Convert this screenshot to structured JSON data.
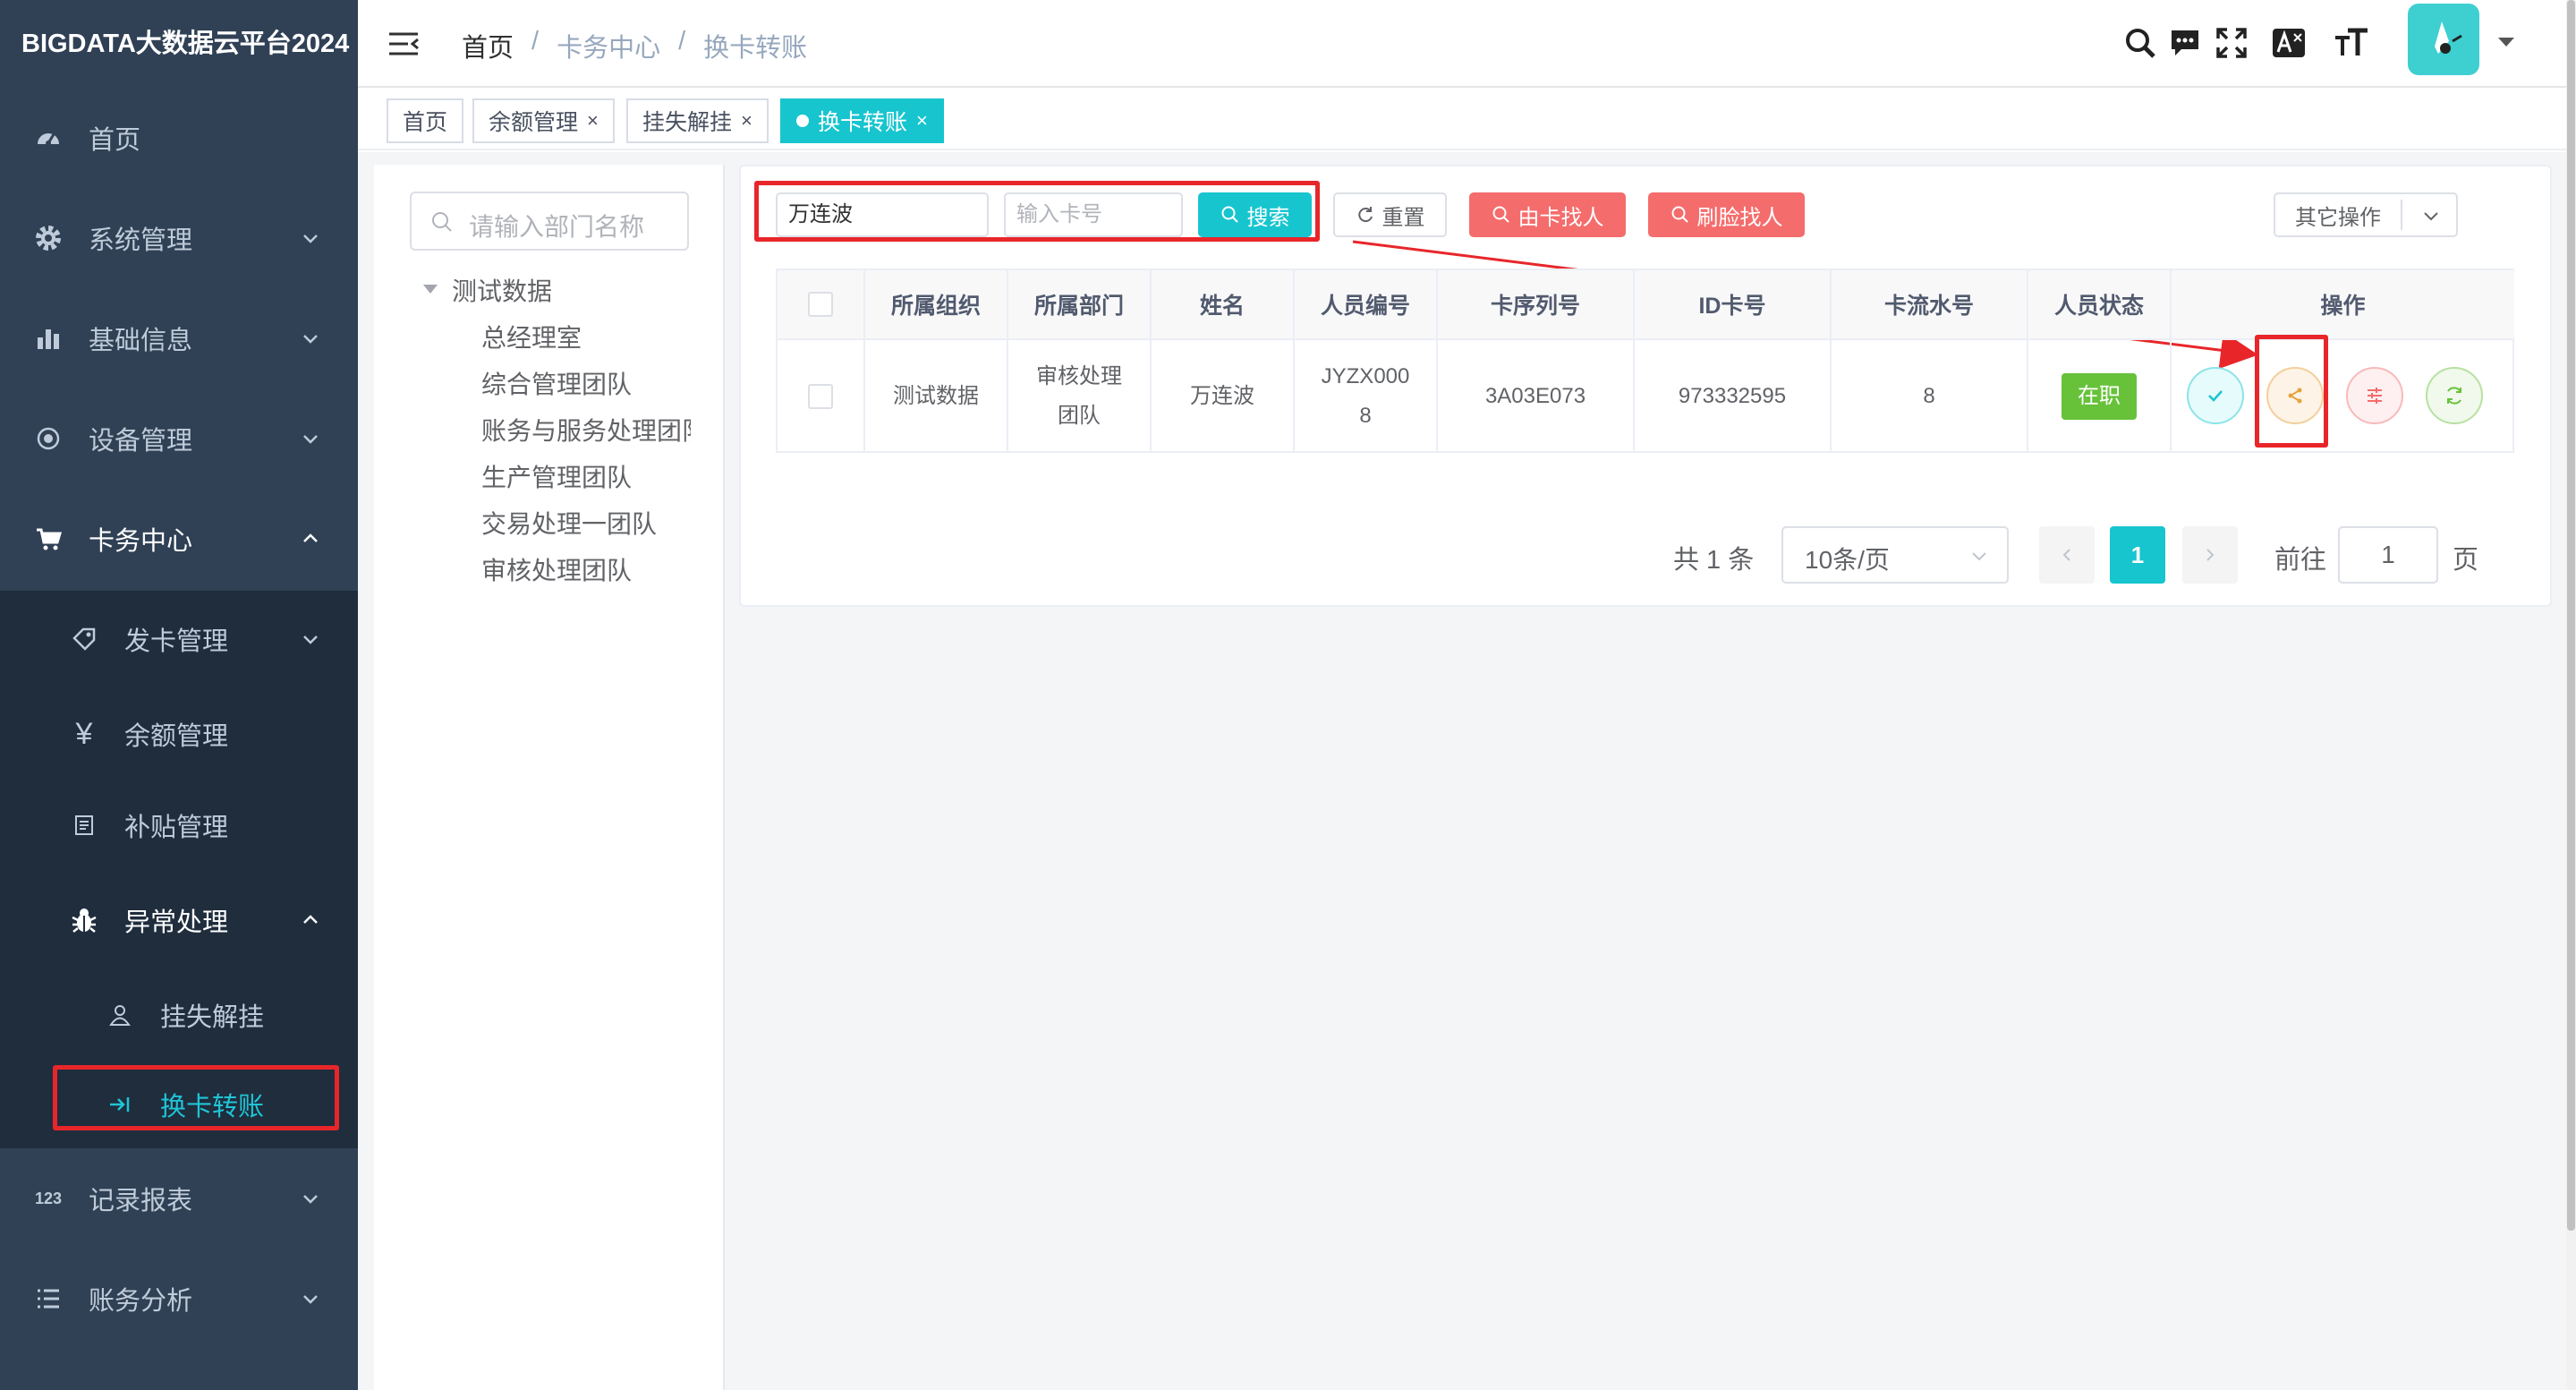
{
  "app": {
    "title": "BIGDATA大数据云平台2024"
  },
  "sidebar": {
    "items": [
      {
        "label": "首页",
        "icon": "dashboard-icon"
      },
      {
        "label": "系统管理",
        "icon": "gear-icon"
      },
      {
        "label": "基础信息",
        "icon": "bar-chart-icon"
      },
      {
        "label": "设备管理",
        "icon": "radio-icon"
      },
      {
        "label": "卡务中心",
        "icon": "cart-icon"
      },
      {
        "label": "发卡管理",
        "icon": "tag-icon"
      },
      {
        "label": "余额管理",
        "icon": "yen-icon"
      },
      {
        "label": "补贴管理",
        "icon": "document-icon"
      },
      {
        "label": "异常处理",
        "icon": "bug-icon"
      },
      {
        "label": "挂失解挂",
        "icon": "user-icon"
      },
      {
        "label": "换卡转账",
        "icon": "login-arrow-icon"
      },
      {
        "label": "记录报表",
        "icon": "numbers-icon"
      },
      {
        "label": "账务分析",
        "icon": "list-icon"
      }
    ]
  },
  "header": {
    "breadcrumb": [
      "首页",
      "卡务中心",
      "换卡转账"
    ],
    "breadcrumb_sep": "/",
    "icons": [
      "search-icon",
      "message-icon",
      "fullscreen-icon",
      "translate-icon",
      "font-size-icon"
    ]
  },
  "tags": [
    {
      "label": "首页"
    },
    {
      "label": "余额管理"
    },
    {
      "label": "挂失解挂"
    },
    {
      "label": "换卡转账"
    }
  ],
  "tag_close": "×",
  "dept_tree": {
    "search_placeholder": "请输入部门名称",
    "root": "测试数据",
    "children": [
      "总经理室",
      "综合管理团队",
      "账务与服务处理团队",
      "生产管理团队",
      "交易处理一团队",
      "审核处理团队"
    ]
  },
  "toolbar": {
    "name_value": "万连波",
    "card_placeholder": "输入卡号",
    "search_label": "搜索",
    "reset_label": "重置",
    "find_by_card_label": "由卡找人",
    "find_by_face_label": "刷脸找人",
    "other_ops_label": "其它操作"
  },
  "table": {
    "headers": [
      "所属组织",
      "所属部门",
      "姓名",
      "人员编号",
      "卡序列号",
      "ID卡号",
      "卡流水号",
      "人员状态",
      "操作"
    ],
    "rows": [
      {
        "org": "测试数据",
        "dept_line1": "审核处理",
        "dept_line2": "团队",
        "name": "万连波",
        "emp_no_line1": "JYZX000",
        "emp_no_line2": "8",
        "card_serial": "3A03E073",
        "id_card": "973332595",
        "card_flow": "8",
        "status": "在职"
      }
    ],
    "action_icons": [
      "check-icon",
      "share-icon",
      "sliders-icon",
      "refresh-icon"
    ]
  },
  "pagination": {
    "total_text": "共 1 条",
    "page_size": "10条/页",
    "current_page": "1",
    "goto_label": "前往",
    "goto_value": "1",
    "page_suffix": "页"
  },
  "colors": {
    "sidebar_bg": "#304156",
    "submenu_bg": "#1f2d3d",
    "accent": "#17c5cf",
    "danger": "#f56c6c",
    "success": "#67c23a",
    "annotation_red": "#e8262a"
  }
}
